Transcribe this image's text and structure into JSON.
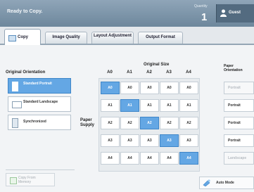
{
  "header": {
    "status": "Ready to Copy.",
    "quantity_label": "Quantity",
    "quantity": "1",
    "user_label": "Guest"
  },
  "tabs": [
    {
      "label": "Copy",
      "active": true
    },
    {
      "label": "Image Quality"
    },
    {
      "label": "Layout Adjustment"
    },
    {
      "label": "Output Format"
    }
  ],
  "original_orientation": {
    "title": "Original Orientation",
    "options": [
      {
        "label": "Standard Portrait",
        "selected": true
      },
      {
        "label": "Standard Landscape"
      },
      {
        "label": "Synchronized"
      }
    ]
  },
  "size_grid": {
    "title": "Original Size",
    "paper_supply_label": "Paper Supply",
    "columns": [
      "A0",
      "A1",
      "A2",
      "A3",
      "A4"
    ],
    "rows": [
      [
        "A0",
        "A0",
        "A0",
        "A0",
        "A0"
      ],
      [
        "A1",
        "A1",
        "A1",
        "A1",
        "A1"
      ],
      [
        "A2",
        "A2",
        "A2",
        "A2",
        "A2"
      ],
      [
        "A3",
        "A3",
        "A3",
        "A3",
        "A3"
      ],
      [
        "A4",
        "A4",
        "A4",
        "A4",
        "A4"
      ]
    ],
    "selected_diagonal": true
  },
  "paper_orientation": {
    "title": "Paper Orientation",
    "options": [
      {
        "label": "Portrait",
        "disabled": true
      },
      {
        "label": "Portrait"
      },
      {
        "label": "Portrait"
      },
      {
        "label": "Portrait"
      },
      {
        "label": "Landscape",
        "disabled": true
      }
    ]
  },
  "footer": {
    "copy_from_memory": "Copy From Memory",
    "auto_mode": "Auto Mode"
  },
  "colors": {
    "header": "#7a92a6",
    "selected": "#64a7e4",
    "background": "#f2f4f6"
  }
}
